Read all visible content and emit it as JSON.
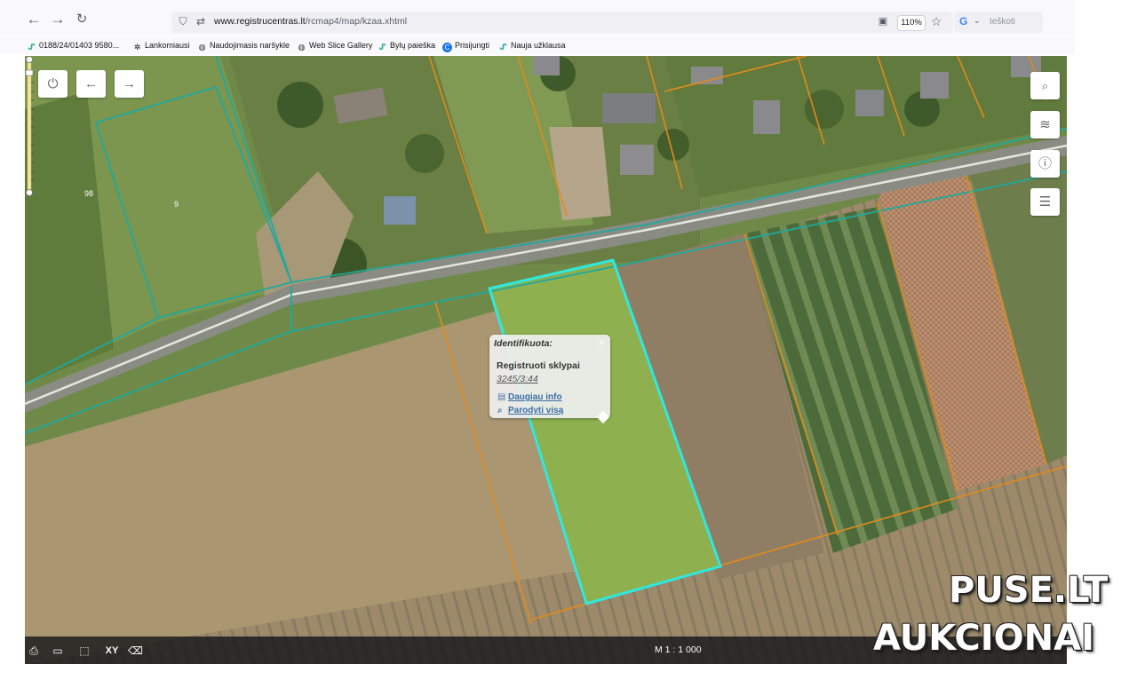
{
  "browser": {
    "back_icon": "arrow-left-icon",
    "forward_icon": "arrow-right-icon",
    "reload_icon": "reload-icon",
    "url_domain": "www.registrucentras.lt",
    "url_path": "/rcmap4/map/kzaa.xhtml",
    "zoom_level": "110%",
    "search_engine_letter": "G",
    "search_placeholder": "Ieškoti"
  },
  "bookmarks": [
    {
      "label": "0188/24/01403  9580...",
      "icon": "registrucentras-icon"
    },
    {
      "label": "Lankomiausi",
      "icon": "gear-icon"
    },
    {
      "label": "Naudojimasis naršykle",
      "icon": "globe-icon"
    },
    {
      "label": "Web Slice Gallery",
      "icon": "globe-icon"
    },
    {
      "label": "Bylų paieška",
      "icon": "registrucentras-icon"
    },
    {
      "label": "Prisijungti",
      "icon": "c-logo-icon"
    },
    {
      "label": "Nauja užklausa",
      "icon": "registrucentras-icon"
    }
  ],
  "map": {
    "plot_labels": [
      "98",
      "9"
    ],
    "top_buttons": [
      "power-icon",
      "arrow-left-icon",
      "arrow-right-icon"
    ],
    "side_buttons": [
      "search-icon",
      "layers-icon",
      "info-icon",
      "legend-icon"
    ],
    "popup": {
      "title": "Identifikuota:",
      "close": "×",
      "layer_name": "Registruoti sklypai",
      "parcel_number": "3245/3:44",
      "more_info": "Daugiau info",
      "show_all": "Parodyti visą"
    },
    "tools": [
      "print-icon",
      "ruler-icon",
      "select-area-icon",
      "XY",
      "eraser-icon"
    ],
    "scale_text": "M 1 : 1 000"
  },
  "watermark": {
    "line1": "PUSE.LT",
    "line2": "AUKCIONAI"
  }
}
